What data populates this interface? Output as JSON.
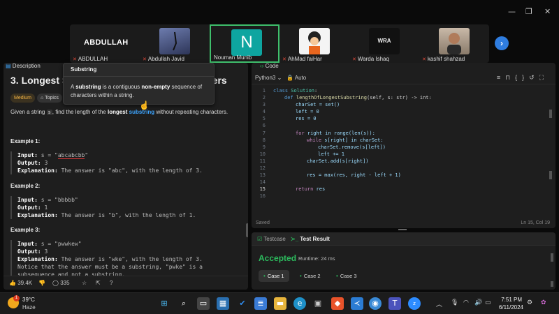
{
  "participants": [
    {
      "name": "ABDULLAH",
      "tile_label": "ABDULLAH"
    },
    {
      "name": "Abdullah Javid"
    },
    {
      "name": "Nouman Munib",
      "initial": "N"
    },
    {
      "name": "AhMad faiHar"
    },
    {
      "name": "Warda Ishaq",
      "logo_text": "WRA"
    },
    {
      "name": "kashif shahzad"
    }
  ],
  "problem": {
    "desc_tab": "Description",
    "title": "3. Longest S",
    "title_tail": "ters",
    "difficulty": "Medium",
    "topics": "Topics",
    "given_pre": "Given a string ",
    "given_var": "s",
    "given_mid": ", find the length of the ",
    "given_bold": "longest",
    "given_link": "substring",
    "given_post": " without repeating characters.",
    "examples": [
      {
        "heading": "Example 1:",
        "input_label": "Input:",
        "input_pre": " s = \"",
        "input_val": "abcabcbb",
        "input_post": "\"",
        "output_label": "Output:",
        "output_val": " 3",
        "expl_label": "Explanation:",
        "expl_val": " The answer is \"abc\", with the length of 3."
      },
      {
        "heading": "Example 2:",
        "input_label": "Input:",
        "input_pre": " s = \"",
        "input_val": "bbbbb",
        "input_post": "\"",
        "output_label": "Output:",
        "output_val": " 1",
        "expl_label": "Explanation:",
        "expl_val": " The answer is \"b\", with the length of 1."
      },
      {
        "heading": "Example 3:",
        "input_label": "Input:",
        "input_pre": " s = \"",
        "input_val": "pwwkew",
        "input_post": "\"",
        "output_label": "Output:",
        "output_val": " 3",
        "expl_label": "Explanation:",
        "expl_val": " The answer is \"wke\", with the length of 3.",
        "extra": "Notice that the answer must be a substring, \"pwke\" is a",
        "extra2": "subsequence and not a substring."
      }
    ],
    "likes": "39.4K",
    "comments": "335"
  },
  "tooltip": {
    "title": "Substring",
    "body_pre": "A ",
    "body_b1": "substring",
    "body_mid": " is a contiguous ",
    "body_b2": "non-empty",
    "body_post": " sequence of characters within a string."
  },
  "editor": {
    "tab": "Code",
    "language": "Python3",
    "mode": "Auto",
    "status_saved": "Saved",
    "cursor_pos": "Ln 15, Col 19",
    "lines": [
      {
        "n": "1"
      },
      {
        "n": "2"
      },
      {
        "n": "3"
      },
      {
        "n": "4"
      },
      {
        "n": "5"
      },
      {
        "n": "6"
      },
      {
        "n": "7"
      },
      {
        "n": "8"
      },
      {
        "n": "9"
      },
      {
        "n": "10"
      },
      {
        "n": "11"
      },
      {
        "n": "12"
      },
      {
        "n": "13"
      },
      {
        "n": "14"
      },
      {
        "n": "15"
      },
      {
        "n": "16"
      }
    ],
    "code_text": {
      "l1_kw": "class",
      "l1_name": " Solution",
      "l1_rest": ":",
      "l2_kw": "def",
      "l2_fn": " lengthOfLongestSubstring",
      "l2_rest": "(self, s: str) -> int:",
      "l3": "charSet = set()",
      "l4": "left = 0",
      "l5": "res = 0",
      "l7_kw": "for",
      "l7_rest": " right in range(len(s)):",
      "l8_kw": "while",
      "l8_rest": " s[right] in charSet:",
      "l9": "charSet.remove(s[left])",
      "l10": "left += 1",
      "l11": "charSet.add(s[right])",
      "l13": "res = max(res, right - left + 1)",
      "l15_kw": "return",
      "l15_rest": " res"
    }
  },
  "testpanel": {
    "tab_testcase": "Testcase",
    "tab_result": "Test Result",
    "status": "Accepted",
    "runtime": "Runtime: 24 ms",
    "cases": [
      "Case 1",
      "Case 2",
      "Case 3"
    ]
  },
  "taskbar": {
    "temperature": "39°C",
    "weather": "Haze",
    "weather_badge": "1",
    "time": "7:51 PM",
    "date": "6/11/2024"
  },
  "colors": {
    "accepted": "#2cbb5d",
    "medium": "#f5b544",
    "link": "#3da5ff",
    "selected_tile_border": "#3fbf6c"
  }
}
